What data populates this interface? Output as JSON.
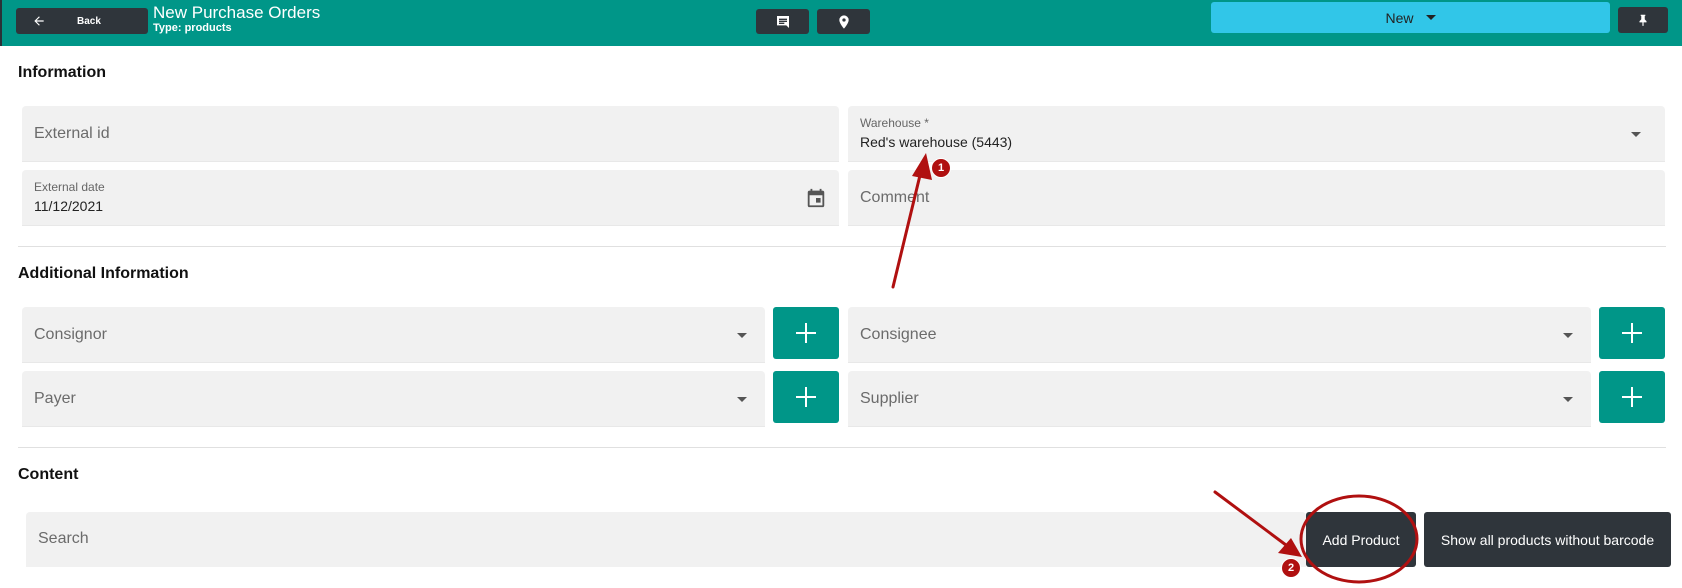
{
  "header": {
    "back_label": "Back",
    "title": "New Purchase Orders",
    "subtitle": "Type: products",
    "comment_icon": "comment-icon",
    "location_icon": "location-pin-icon",
    "status_value": "New",
    "pin_icon": "pin-icon"
  },
  "information": {
    "section_title": "Information",
    "external_id_placeholder": "External id",
    "warehouse_label": "Warehouse *",
    "warehouse_value": "Red's warehouse (5443)",
    "external_date_label": "External date",
    "external_date_value": "11/12/2021",
    "comment_placeholder": "Comment"
  },
  "additional": {
    "section_title": "Additional Information",
    "consignor_placeholder": "Consignor",
    "consignee_placeholder": "Consignee",
    "payer_placeholder": "Payer",
    "supplier_placeholder": "Supplier"
  },
  "content": {
    "section_title": "Content",
    "search_placeholder": "Search",
    "add_product_label": "Add Product",
    "show_without_barcode_label": "Show all products without barcode"
  },
  "annotations": {
    "badge_1": "1",
    "badge_2": "2"
  },
  "colors": {
    "primary": "#009688",
    "dark_button": "#2f353b",
    "status_select": "#31c6e8",
    "annotation_red": "#b01010"
  }
}
